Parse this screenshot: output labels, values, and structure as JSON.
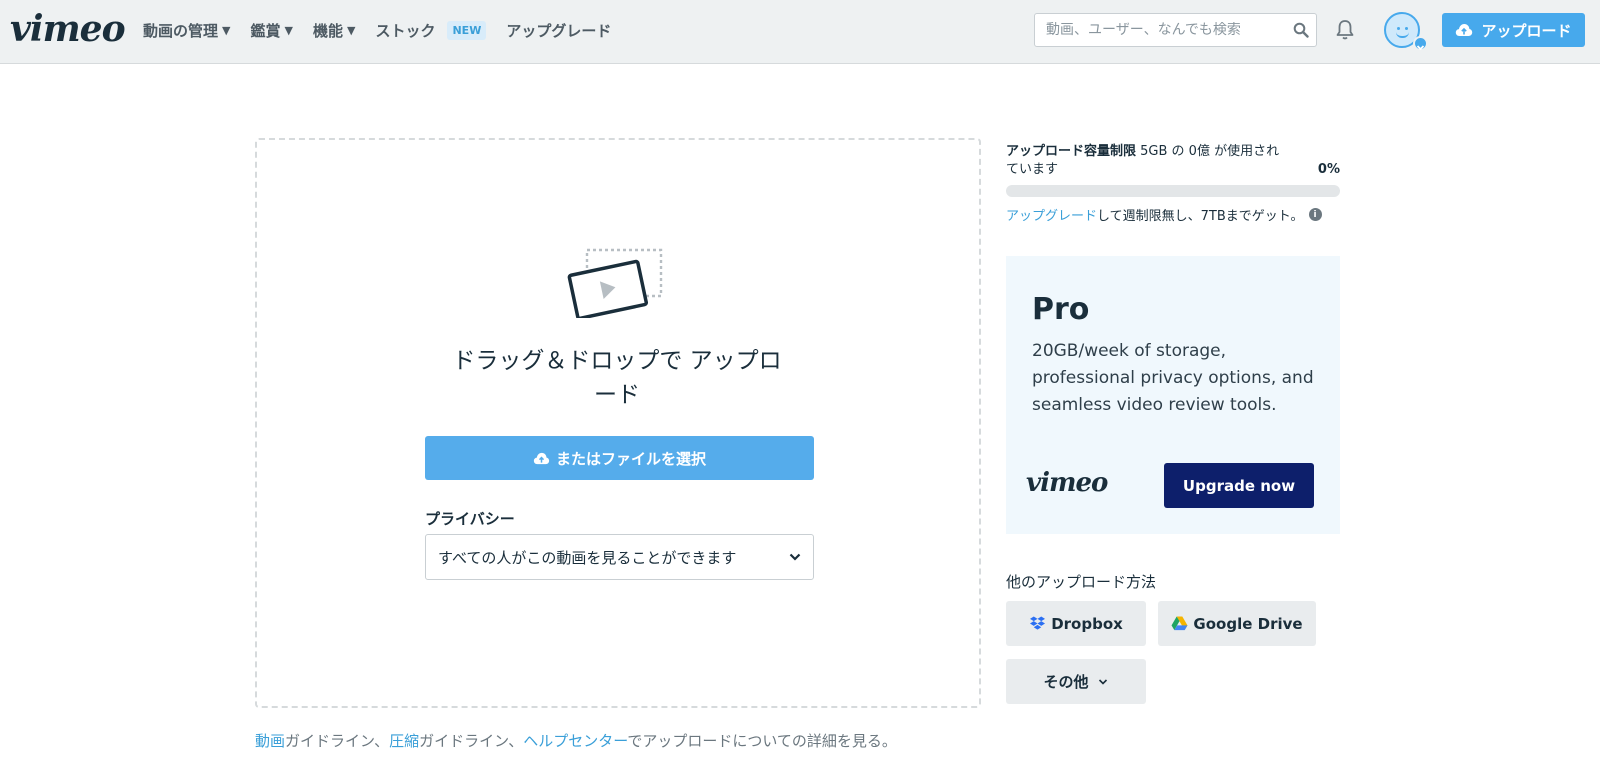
{
  "header": {
    "logo": "vimeo",
    "nav": [
      {
        "label": "動画の管理",
        "has_dropdown": true
      },
      {
        "label": "鑑賞",
        "has_dropdown": true
      },
      {
        "label": "機能",
        "has_dropdown": true
      },
      {
        "label": "ストック",
        "has_dropdown": false,
        "badge": "NEW"
      },
      {
        "label": "アップグレード",
        "has_dropdown": false
      }
    ],
    "search_placeholder": "動画、ユーザー、なんでも検索",
    "upload_label": "アップロード"
  },
  "dropzone": {
    "title": "ドラッグ＆ドロップで アップロード",
    "choose_button": "またはファイルを選択",
    "privacy_label": "プライバシー",
    "privacy_value": "すべての人がこの動画を見ることができます"
  },
  "footer_note": {
    "link1": "動画",
    "text1": "ガイドライン、",
    "link2": "圧縮",
    "text2": "ガイドライン、",
    "link3": "ヘルプセンター",
    "text3": "でアップロードについての詳細を見る。"
  },
  "quota": {
    "label": "アップロード容量制限",
    "detail": "5GB の 0億 が使用されています",
    "percent_text": "0%",
    "used_fraction": 0,
    "upgrade_link": "アップグレード",
    "upgrade_text": "して週制限無し、7TBまでゲット。"
  },
  "pro_card": {
    "title": "Pro",
    "description": "20GB/week of storage, professional privacy options, and seamless video review tools.",
    "logo": "vimeo",
    "button": "Upgrade now"
  },
  "other_methods": {
    "title": "他のアップロード方法",
    "dropbox": "Dropbox",
    "google_drive": "Google Drive",
    "more": "その他"
  },
  "colors": {
    "accent": "#47a9ec",
    "pro_button": "#0d1f6b",
    "header_bg": "#eef1f2"
  }
}
